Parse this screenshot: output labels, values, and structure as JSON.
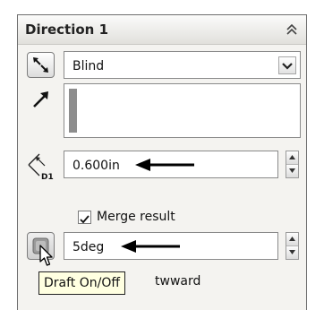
{
  "panel": {
    "title": "Direction 1",
    "end_condition": {
      "selected": "Blind"
    },
    "depth": {
      "value": "0.600in"
    },
    "merge_result": {
      "label": "Merge result",
      "checked": true
    },
    "draft": {
      "value": "5deg",
      "tooltip": "Draft On/Off",
      "partial_option_label": "twward"
    }
  },
  "icons": {
    "collapse": "chevron-up-double-icon",
    "reverse_direction": "reverse-direction-icon",
    "direction_arrow": "arrow-direction-icon",
    "depth": "dimension-d1-icon",
    "draft_toggle": "draft-toggle-icon",
    "cursor": "mouse-pointer-icon",
    "annotation_arrow": "black-arrow-icon"
  }
}
